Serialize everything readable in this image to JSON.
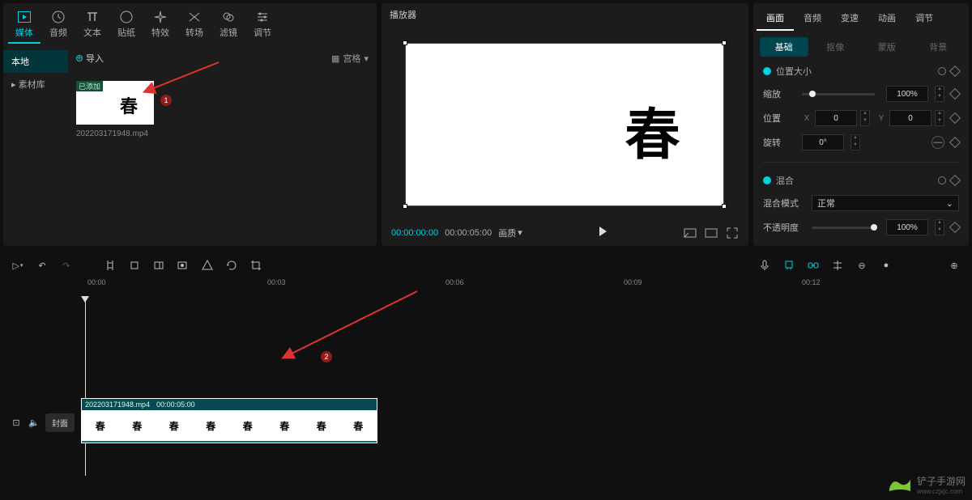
{
  "topTabs": [
    {
      "label": "媒体",
      "icon": "film-icon"
    },
    {
      "label": "音频",
      "icon": "clock-icon"
    },
    {
      "label": "文本",
      "icon": "text-icon"
    },
    {
      "label": "贴纸",
      "icon": "sticker-icon"
    },
    {
      "label": "特效",
      "icon": "sparkle-icon"
    },
    {
      "label": "转场",
      "icon": "transition-icon"
    },
    {
      "label": "滤镜",
      "icon": "filter-icon"
    },
    {
      "label": "调节",
      "icon": "sliders-icon"
    }
  ],
  "sidebar": {
    "items": [
      "本地",
      "素材库"
    ],
    "activeIndex": 0
  },
  "mediaBar": {
    "import": "导入",
    "viewLabel": "宫格"
  },
  "thumb": {
    "badge": "已添加",
    "char": "春",
    "filename": "202203171948.mp4"
  },
  "player": {
    "title": "播放器",
    "charOverlay": "春",
    "currentTime": "00:00:00:00",
    "totalTime": "00:00:05:00",
    "aspect": "画质"
  },
  "propTabs": [
    "画面",
    "音频",
    "变速",
    "动画",
    "调节"
  ],
  "propSubtabs": [
    "基础",
    "抠像",
    "蒙版",
    "背景"
  ],
  "props": {
    "posSize": {
      "title": "位置大小"
    },
    "scale": {
      "label": "缩放",
      "value": "100%",
      "knob": 10
    },
    "pos": {
      "label": "位置",
      "x": "0",
      "y": "0"
    },
    "rot": {
      "label": "旋转",
      "value": "0°"
    },
    "blend": {
      "title": "混合"
    },
    "blendMode": {
      "label": "混合模式",
      "value": "正常"
    },
    "opacity": {
      "label": "不透明度",
      "value": "100%",
      "knob": 94
    }
  },
  "ruler": {
    "ticks": [
      "00:00",
      "00:03",
      "00:06",
      "00:09",
      "00:12"
    ]
  },
  "clip": {
    "name": "202203171948.mp4",
    "dur": "00:00:05:00"
  },
  "trackHead": {
    "cover": "封面"
  },
  "annotations": {
    "num1": "1",
    "num2": "2"
  },
  "watermark": {
    "brand": "铲子手游网",
    "url": "www.czjxjc.com"
  }
}
